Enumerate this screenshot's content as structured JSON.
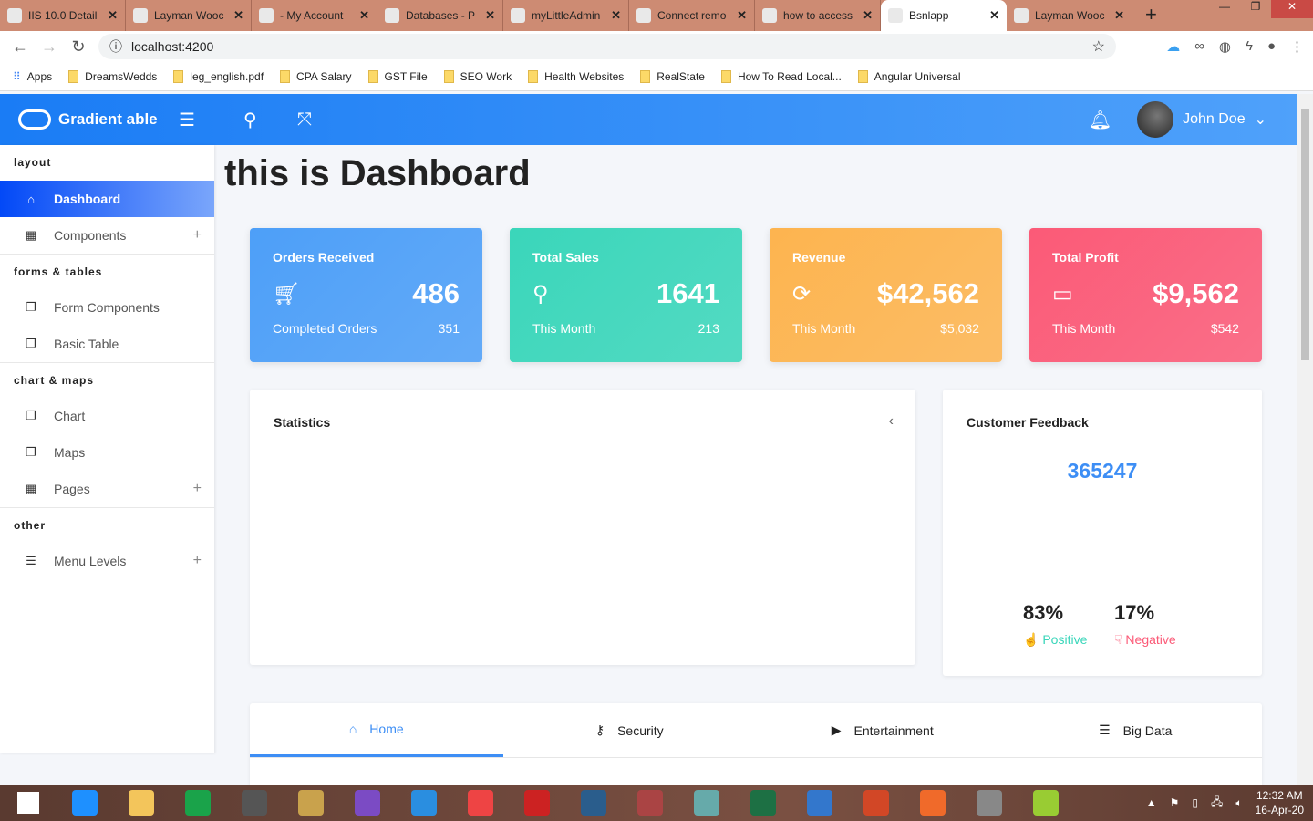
{
  "browser": {
    "tabs": [
      "IIS 10.0 Detail",
      "Layman Wooc",
      "- My Account",
      "Databases - P",
      "myLittleAdmin",
      "Connect remo",
      "how to access",
      "Bsnlapp",
      "Layman Wooc"
    ],
    "active_tab": 7,
    "url": "localhost:4200",
    "bookmarks": [
      "Apps",
      "DreamsWedds",
      "leg_english.pdf",
      "CPA Salary",
      "GST File",
      "SEO Work",
      "Health Websites",
      "RealState",
      "How To Read Local...",
      "Angular Universal"
    ]
  },
  "header": {
    "brand": "Gradient able",
    "user": "John Doe"
  },
  "sidebar": {
    "sections": [
      {
        "caption": "layout",
        "items": [
          {
            "label": "Dashboard",
            "icon": "home-icon",
            "active": true
          },
          {
            "label": "Components",
            "icon": "grid-icon",
            "expand": true
          }
        ]
      },
      {
        "caption": "forms & tables",
        "items": [
          {
            "label": "Form Components",
            "icon": "layers-icon"
          },
          {
            "label": "Basic Table",
            "icon": "layers-icon"
          }
        ]
      },
      {
        "caption": "chart & maps",
        "items": [
          {
            "label": "Chart",
            "icon": "layers-icon"
          },
          {
            "label": "Maps",
            "icon": "layers-icon"
          },
          {
            "label": "Pages",
            "icon": "grid-icon",
            "expand": true
          }
        ]
      },
      {
        "caption": "other",
        "items": [
          {
            "label": "Menu Levels",
            "icon": "menu-icon",
            "expand": true
          }
        ]
      }
    ]
  },
  "page": {
    "title": "this is Dashboard"
  },
  "cards": [
    {
      "title": "Orders Received",
      "value": "486",
      "sub_label": "Completed Orders",
      "sub_value": "351",
      "icon": "cart-icon",
      "color": "#4d9ff8"
    },
    {
      "title": "Total Sales",
      "value": "1641",
      "sub_label": "This Month",
      "sub_value": "213",
      "icon": "award-icon",
      "color": "#3ad6ba"
    },
    {
      "title": "Revenue",
      "value": "$42,562",
      "sub_label": "This Month",
      "sub_value": "$5,032",
      "icon": "refresh-icon",
      "color": "#fdb44f"
    },
    {
      "title": "Total Profit",
      "value": "$9,562",
      "sub_label": "This Month",
      "sub_value": "$542",
      "icon": "wallet-icon",
      "color": "#fb5a77"
    }
  ],
  "statistics": {
    "title": "Statistics"
  },
  "feedback": {
    "title": "Customer Feedback",
    "count": "365247",
    "positive_pct": "83%",
    "positive_label": "Positive",
    "negative_pct": "17%",
    "negative_label": "Negative"
  },
  "bottom_tabs": [
    "Home",
    "Security",
    "Entertainment",
    "Big Data"
  ],
  "taskbar": {
    "time": "12:32 AM",
    "date": "16-Apr-20"
  }
}
